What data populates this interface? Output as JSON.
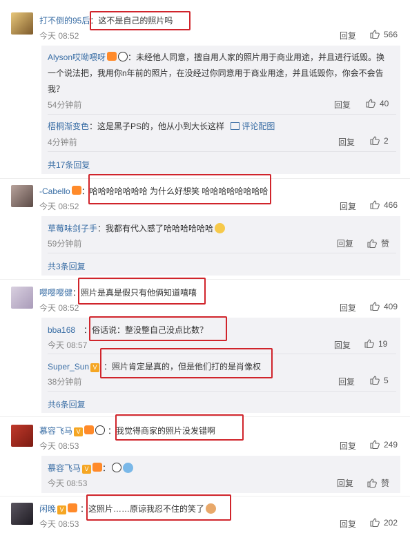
{
  "reply_label": "回复",
  "c1": {
    "user": "打不倒的95后",
    "text": "：这不是自己的照片吗",
    "time": "今天 08:52",
    "likes": "566",
    "replies": [
      {
        "user": "Alyson哎呦喂呀",
        "text_line1": "：未经他人同意，擅自用人家的照片用于商业用途，并且进行诋毁。换",
        "text_line2": "一个说法把，我用你n年前的照片，在没经过你同意用于商业用途，并且诋毁你，你会不会告",
        "text_line3": "我？",
        "time": "54分钟前",
        "likes": "40"
      },
      {
        "user": "梧桐渐变色",
        "text": "：这是黑子PS的，他从小到大长这样",
        "pic_label": "评论配图",
        "time": "4分钟前",
        "likes": "2"
      }
    ],
    "more": "共17条回复"
  },
  "c2": {
    "user": "-Cabello",
    "text": "：哈哈哈哈哈哈哈 为什么好想笑 哈哈哈哈哈哈哈哈",
    "time": "今天 08:52",
    "likes": "466",
    "replies": [
      {
        "user": "草莓味剑子手",
        "text": "：我都有代入感了哈哈哈哈哈哈",
        "time": "59分钟前",
        "likes": "赞"
      }
    ],
    "more": "共3条回复"
  },
  "c3": {
    "user": "嘤嘤嘤健",
    "text": "：照片是真是假只有他俩知道嘻嘻",
    "time": "今天 08:52",
    "likes": "409",
    "replies": [
      {
        "user": "bba168",
        "text": "：俗话说：整没整自己没点比数？",
        "time": "今天 08:57",
        "likes": "19"
      },
      {
        "user": "Super_Sun",
        "text": "：照片肯定是真的，但是他们打的是肖像权",
        "time": "38分钟前",
        "likes": "5"
      }
    ],
    "more": "共6条回复"
  },
  "c4": {
    "user": "慕容飞马",
    "text": "：我觉得商家的照片没发错啊",
    "time": "今天 08:53",
    "likes": "249",
    "replies": [
      {
        "user": "慕容飞马",
        "text": "：",
        "time": "今天 08:53",
        "likes": "赞"
      }
    ]
  },
  "c5": {
    "user": "闲晚",
    "text": "：这照片……原谅我忍不住的笑了",
    "time": "今天 08:53",
    "likes": "202"
  },
  "colors": {
    "link": "#3a6ea5",
    "highlight_box": "#d0242b"
  }
}
